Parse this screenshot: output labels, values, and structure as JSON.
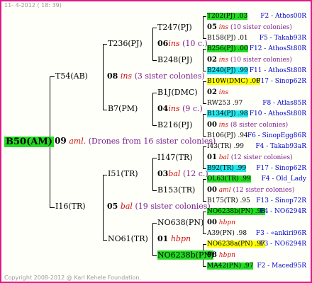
{
  "header": {
    "date": "11-  4-2012 ( 18: 39)"
  },
  "footer": {
    "copyright": "Copyright 2008-2012 @ Karl Kehele Foundation."
  },
  "root": {
    "name": "B50(AM)",
    "gen": "09",
    "mark": "aml.",
    "note": "(Drones from 16 sister colonies)"
  },
  "gen1": {
    "upper": {
      "name": "T54(AB)",
      "gen": "08",
      "mark": "ins",
      "note": "(3 sister colonies)"
    },
    "lower": {
      "name": "I16(TR)",
      "gen": "05",
      "mark": "bal",
      "note": "(19 sister colonies)"
    }
  },
  "gen2": {
    "a": {
      "name": "T236(PJ)",
      "gen": "06",
      "mark": "ins",
      "note": "(10 c.)"
    },
    "b": {
      "name": "B7(PM)",
      "gen": "04",
      "mark": "ins",
      "note": "(9 c.)"
    },
    "c": {
      "name": "I51(TR)",
      "gen": "03",
      "mark": "bal",
      "note": "(12 c.)"
    },
    "d": {
      "name": "NO61(TR)",
      "gen": "01",
      "mark": "hbpn",
      "note": ""
    }
  },
  "gen3": {
    "a": {
      "name": "T247(PJ)",
      "gen": "05",
      "mark": "ins",
      "note": "(10 sister colonies)"
    },
    "b": {
      "name": "B248(PJ)",
      "gen": "02",
      "mark": "ins",
      "note": "(10 sister colonies)"
    },
    "c": {
      "name": "B1J(DMC)",
      "gen": "02",
      "mark": "ins",
      "note": ""
    },
    "d": {
      "name": "B216(PJ)",
      "gen": "00",
      "mark": "ins",
      "note": "(8 sister colonies)"
    },
    "e": {
      "name": "I147(TR)",
      "gen": "01",
      "mark": "bal",
      "note": "(12 sister colonies)"
    },
    "f": {
      "name": "B153(TR)",
      "gen": "00",
      "mark": "aml",
      "note": "(12 sister colonies)"
    },
    "g": {
      "name": "NO638(PN)",
      "gen": "00",
      "mark": "hbpn",
      "note": ""
    },
    "h": {
      "name": "NO6238b(PN)",
      "gen": "98",
      "mark": "hbpn",
      "note": ""
    }
  },
  "gen4": [
    {
      "left": "T202(PJ) .03",
      "right": "F2 - Athos00R",
      "hl": "green"
    },
    {
      "left": "B158(PJ) .01",
      "right": "F5 - Takab93R",
      "hl": ""
    },
    {
      "left": "B256(PJ) .00",
      "right": "F12 - AthosSt80R",
      "hl": "green"
    },
    {
      "left": "B240(PJ) .99",
      "right": "F11 - AthosSt80R",
      "hl": "cyan"
    },
    {
      "left": "B10W(DMC) .00",
      "right": "F17 - Sinop62R",
      "hl": "yellow"
    },
    {
      "left": "RW253 .97",
      "right": "F8 - Atlas85R",
      "hl": ""
    },
    {
      "left": "B134(PJ) .98",
      "right": "F10 - AthosSt80R",
      "hl": "cyan"
    },
    {
      "left": "B106(PJ) .94",
      "right": "F6 - SinopEgg86R",
      "hl": ""
    },
    {
      "left": "I43(TR) .99",
      "right": "F4 - Takab93aR",
      "hl": ""
    },
    {
      "left": "B92(TR) .99",
      "right": "F17 - Sinop62R",
      "hl": "cyan"
    },
    {
      "left": "OL63(TR) .99",
      "right": "F4 - Old_Lady",
      "hl": "green"
    },
    {
      "left": "B175(TR) .95",
      "right": "F13 - Sinop72R",
      "hl": ""
    },
    {
      "left": "NO6238b(PN) .98",
      "right": "F4 - NO6294R",
      "hl": "green"
    },
    {
      "left": "A39(PN) .98",
      "right": "F3 - «ankiri96R",
      "hl": ""
    },
    {
      "left": "NO6238a(PN) .97",
      "right": "F3 - NO6294R",
      "hl": "yellow"
    },
    {
      "left": "MA42(PN) .97",
      "right": "F2 - Maced95R",
      "hl": "green"
    }
  ]
}
